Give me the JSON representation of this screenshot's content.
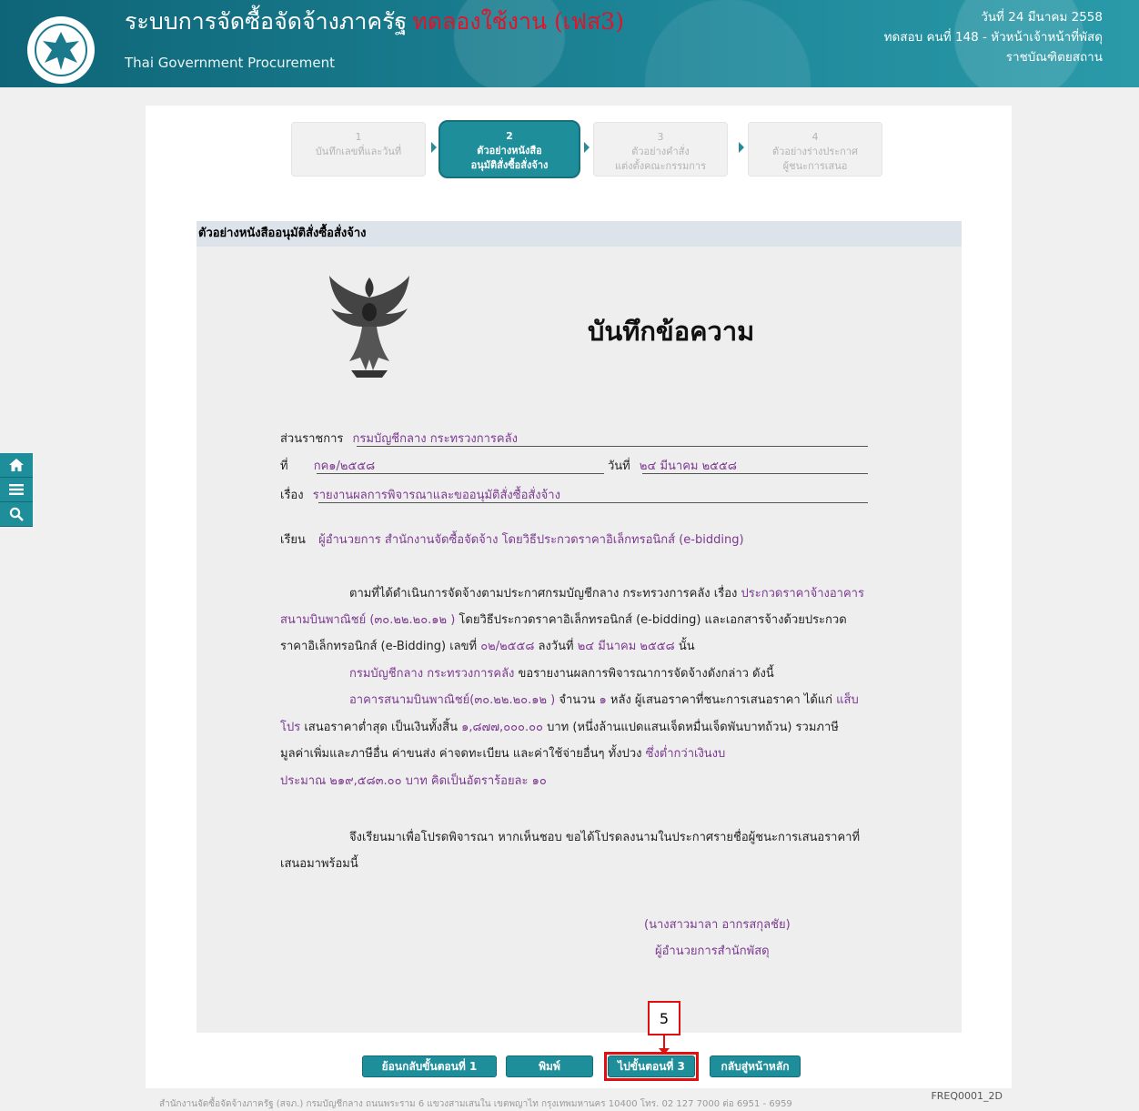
{
  "header": {
    "title_main": "ระบบการจัดซื้อจัดจ้างภาครัฐ",
    "title_trial": "ทดลองใช้งาน (เฟส3)",
    "title_sub": "Thai Government Procurement",
    "date_line": "วันที่ 24 มีนาคม 2558",
    "user_line": "ทดสอบ คนที่ 148 - หัวหน้าเจ้าหน้าที่พัสดุ",
    "org_line": "ราชบัณฑิตยสถาน"
  },
  "sidebar": {
    "icons": [
      "home-icon",
      "menu-icon",
      "search-icon"
    ]
  },
  "steps": [
    {
      "num": "1",
      "line1": "บันทึกเลขที่และวันที่",
      "line2": ""
    },
    {
      "num": "2",
      "line1": "ตัวอย่างหนังสือ",
      "line2": "อนุมัติสั่งซื้อสั่งจ้าง"
    },
    {
      "num": "3",
      "line1": "ตัวอย่างคำสั่ง",
      "line2": "แต่งตั้งคณะกรรมการ"
    },
    {
      "num": "4",
      "line1": "ตัวอย่างร่างประกาศ",
      "line2": "ผู้ชนะการเสนอ"
    }
  ],
  "section_title": "ตัวอย่างหนังสืออนุมัติสั่งซื้อสั่งจ้าง",
  "memo": {
    "title": "บันทึกข้อความ",
    "agency_label": "ส่วนราชการ",
    "agency_value": "กรมบัญชีกลาง กระทรวงการคลัง",
    "ref_label": "ที่",
    "ref_value": "กค๑/๒๕๕๘",
    "date_label": "วันที่",
    "date_value": "๒๔ มีนาคม ๒๕๕๘",
    "subject_label": "เรื่อง",
    "subject_value": "รายงานผลการพิจารณาและขออนุมัติสั่งซื้อสั่งจ้าง",
    "to_label": "เรียน",
    "to_value": "ผู้อำนวยการ สำนักงานจัดซื้อจัดจ้าง โดยวิธีประกวดราคาอิเล็กทรอนิกส์ (e-bidding)",
    "p1_l1_a": "ตามที่ได้ดำเนินการจัดจ้างตามประกาศกรมบัญชีกลาง กระทรวงการคลัง เรื่อง ",
    "p1_l1_b": "ประกวดราคาจ้างอาคาร",
    "p1_l2_a": "สนามบินพาณิชย์ (๓๐.๒๒.๒๐.๑๒ )",
    "p1_l2_b": " โดยวิธีประกวดราคาอิเล็กทรอนิกส์ (e-bidding) และเอกสารจ้างด้วยประกวด",
    "p1_l3_a": "ราคาอิเล็กทรอนิกส์ (e-Bidding) เลขที่ ",
    "p1_l3_b": "๐๒/๒๕๕๘",
    "p1_l3_c": " ลงวันที่ ",
    "p1_l3_d": "๒๔ มีนาคม ๒๕๕๘",
    "p1_l3_e": " นั้น",
    "p2_a": "กรมบัญชีกลาง กระทรวงการคลัง",
    "p2_b": " ขอรายงานผลการพิจารณาการจัดจ้างดังกล่าว ดังนี้",
    "p3_l1_a": "อาคารสนามบินพาณิชย์(๓๐.๒๒.๒๐.๑๒ )",
    "p3_l1_b": " จำนวน ",
    "p3_l1_c": "๑",
    "p3_l1_d": " หลัง ผู้เสนอราคาที่ชนะการเสนอราคา ได้แก่ ",
    "p3_l1_e": "แส็บ",
    "p3_l2_a": "โปร",
    "p3_l2_b": " เสนอราคาต่ำสุด เป็นเงินทั้งสิ้น ",
    "p3_l2_c": "๑,๘๗๗,๐๐๐.๐๐",
    "p3_l2_d": " บาท (หนึ่งล้านแปดแสนเจ็ดหมื่นเจ็ดพันบาทถ้วน) รวมภาษี",
    "p3_l3_a": "มูลค่าเพิ่มและภาษีอื่น ค่าขนส่ง ค่าจดทะเบียน และค่าใช้จ่ายอื่นๆ ทั้งปวง ",
    "p3_l3_b": "ซึ่งต่ำกว่าเงินงบ",
    "p3_l4_a": "ประมาณ ",
    "p3_l4_b": "๒๑๙,๕๘๓.๐๐",
    "p3_l4_c": " บาท คิดเป็นอัตราร้อยละ ",
    "p3_l4_d": "๑๐",
    "p4_l1": "จึงเรียนมาเพื่อโปรดพิจารณา หากเห็นชอบ ขอได้โปรดลงนามในประกาศรายชื่อผู้ชนะการเสนอราคาที่",
    "p4_l2": "เสนอมาพร้อมนี้",
    "sign_name": "(นางสาวมาลา อากรสกุลชัย)",
    "sign_title": "ผู้อำนวยการสำนักพัสดุ"
  },
  "buttons": {
    "back": "ย้อนกลับขั้นตอนที่ 1",
    "print": "พิมพ์",
    "next": "ไปขั้นตอนที่ 3",
    "home": "กลับสู่หน้าหลัก"
  },
  "annotation": {
    "number": "5"
  },
  "footer": {
    "text": "สำนักงานจัดซื้อจัดจ้างภาครัฐ (สจภ.) กรมบัญชีกลาง ถนนพระราม 6 แขวงสามเสนใน เขตพญาไท กรุงเทพมหานคร 10400 โทร. 02 127 7000 ต่อ 6951 - 6959",
    "code": "FREQ0001_2D"
  },
  "colors": {
    "brand": "#1f8e9b",
    "header": "#1a7a8c",
    "highlight": "#e01010",
    "value_text": "#7b3a8f"
  }
}
